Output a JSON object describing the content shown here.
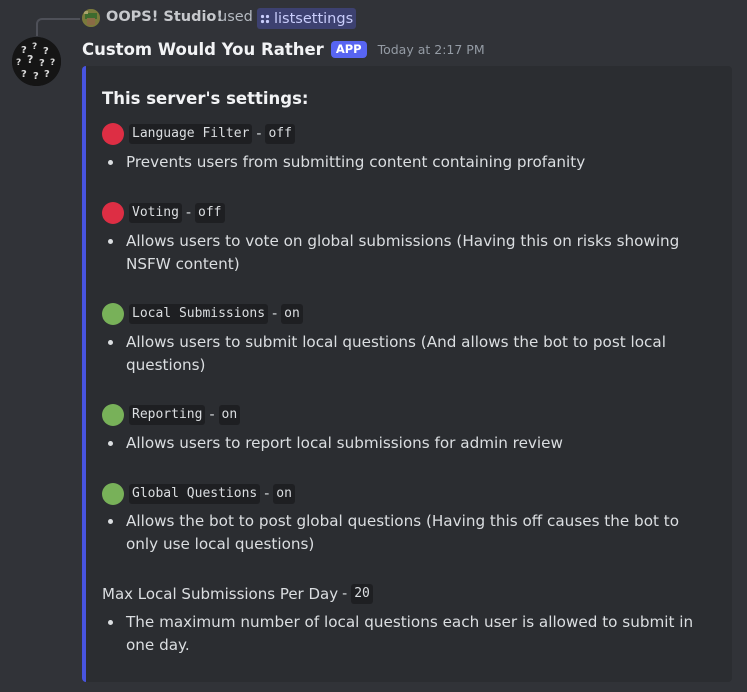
{
  "reply": {
    "user": "OOPS! Studio!",
    "used_text": "used",
    "command": "listsettings"
  },
  "message": {
    "author": "Custom Would You Rather",
    "badge": "APP",
    "timestamp": "Today at 2:17 PM"
  },
  "embed": {
    "title": "This server's settings:",
    "accent_color": "#4854e0",
    "settings": [
      {
        "name": "Language Filter",
        "value": "off",
        "status": "red",
        "description": "Prevents users from submitting content containing profanity"
      },
      {
        "name": "Voting",
        "value": "off",
        "status": "red",
        "description": "Allows users to vote on global submissions (Having this on risks showing NSFW content)"
      },
      {
        "name": "Local Submissions",
        "value": "on",
        "status": "green",
        "description": "Allows users to submit local questions (And allows the bot to post local questions)"
      },
      {
        "name": "Reporting",
        "value": "on",
        "status": "green",
        "description": "Allows users to report local submissions for admin review"
      },
      {
        "name": "Global Questions",
        "value": "on",
        "status": "green",
        "description": "Allows the bot to post global questions (Having this off causes the bot to only use local questions)"
      }
    ],
    "max_setting": {
      "label": "Max Local Submissions Per Day",
      "value": "20",
      "description": "The maximum number of local questions each user is allowed to submit in one day."
    }
  },
  "colors": {
    "status_off": "#dd2e44",
    "status_on": "#78b159",
    "app_badge": "#5865f2"
  },
  "icons": {
    "reply_avatar": "user-avatar-icon",
    "command": "slash-command-icon",
    "author_avatar": "question-marks-avatar-icon"
  }
}
